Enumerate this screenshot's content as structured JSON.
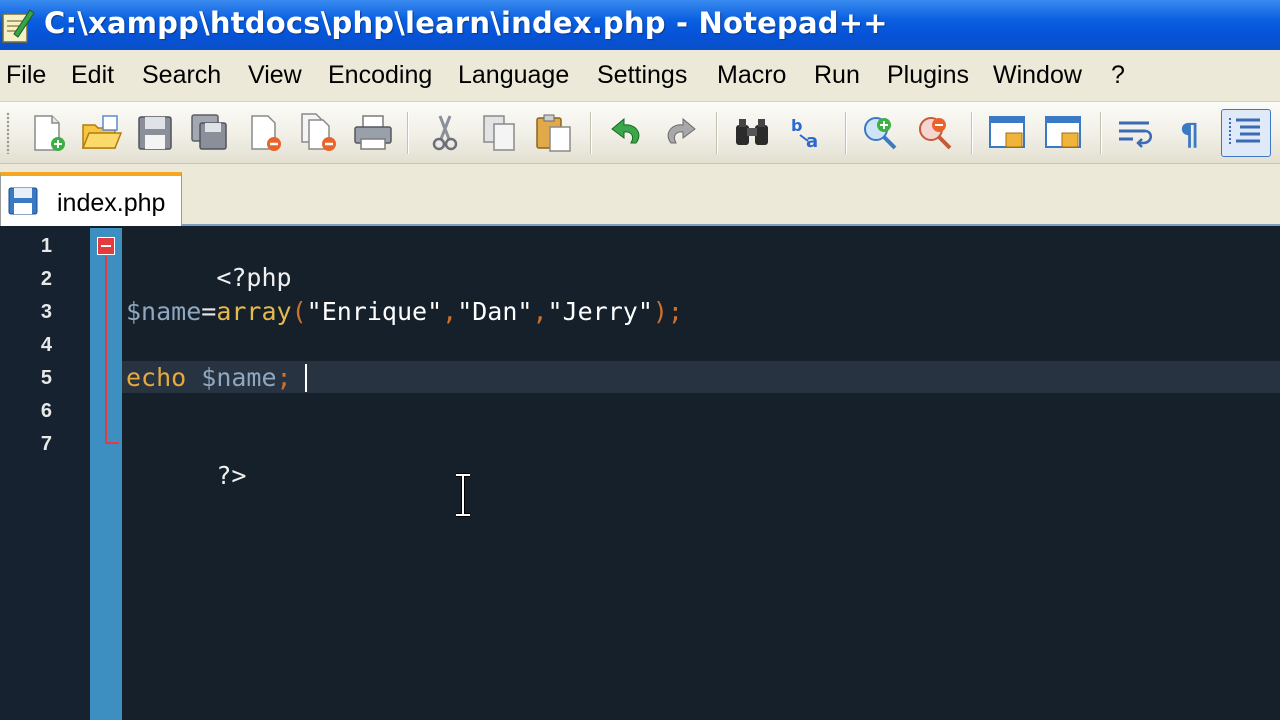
{
  "window": {
    "title": "C:\\xampp\\htdocs\\php\\learn\\index.php - Notepad++",
    "app_icon": "notepad-plus-plus-icon"
  },
  "menu": [
    "File",
    "Edit",
    "Search",
    "View",
    "Encoding",
    "Language",
    "Settings",
    "Macro",
    "Run",
    "Plugins",
    "Window",
    "?"
  ],
  "toolbar": {
    "buttons": [
      "new-file-icon",
      "open-file-icon",
      "save-icon",
      "save-all-icon",
      "close-icon",
      "close-all-icon",
      "print-icon",
      "cut-icon",
      "copy-icon",
      "paste-icon",
      "undo-icon",
      "redo-icon",
      "find-icon",
      "replace-icon",
      "zoom-in-icon",
      "zoom-out-icon",
      "sync-vertical-icon",
      "sync-horizontal-icon",
      "word-wrap-icon",
      "show-all-characters-icon",
      "indent-guide-icon"
    ]
  },
  "tabs": [
    {
      "label": "index.php",
      "icon": "saved-file-icon",
      "active": true
    }
  ],
  "editor": {
    "line_numbers": [
      "1",
      "2",
      "3",
      "4",
      "5",
      "6",
      "7"
    ],
    "lines": {
      "l1_open_tag": "<?php",
      "l3_var": "$name",
      "l3_eq": "=",
      "l3_func": "array",
      "l3_paren_open": "(",
      "l3_str1": "\"Enrique\"",
      "l3_comma1": ",",
      "l3_str2": "\"Dan\"",
      "l3_comma2": ",",
      "l3_str3": "\"Jerry\"",
      "l3_close": ");",
      "l5_kw": "echo",
      "l5_var": " $name",
      "l5_semi": ";",
      "l7_close_tag": "?>"
    },
    "current_line": 5,
    "colors": {
      "background": "#15202b",
      "margin": "#3d8fc2",
      "fold_marker": "#e23c3c",
      "keyword": "#e7a93a",
      "variable": "#8fa7bf",
      "string": "#ffffff"
    }
  }
}
